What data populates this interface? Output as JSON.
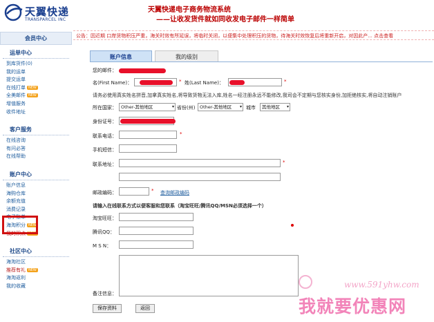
{
  "header": {
    "logo_cn": "天翼快递",
    "logo_en": "TRANSPARCEL INC",
    "slogan1": "天翼快递电子商务物流系统",
    "slogan2": "——让收发货件就如同收发电子邮件一样简单"
  },
  "sidebar": {
    "title": "会员中心",
    "sections": {
      "shipping": {
        "title": "运单中心",
        "items": [
          "到库货件(0)",
          "我的运单",
          "提交运单",
          "在线打单",
          "全美邮件",
          "增值服务",
          "收件地址"
        ],
        "badges": {
          "print": "NEW",
          "mail": "NEW"
        }
      },
      "service": {
        "title": "客户服务",
        "items": [
          "在线咨询",
          "有问必答",
          "在线帮助"
        ]
      },
      "account": {
        "title": "账户中心",
        "items": [
          "账户信息",
          "海购仓库",
          "余额充值",
          "消费记录",
          "电子账单",
          "海淘积分",
          "我的积点"
        ],
        "badges": {
          "points": "NEW",
          "credits": "NEW"
        }
      },
      "community": {
        "title": "社区中心",
        "items": [
          "海淘社区",
          "推荐有礼",
          "海淘返利",
          "我的收藏"
        ],
        "badges": {
          "referral": "NEW"
        }
      }
    }
  },
  "main": {
    "notice": "公告：因近期 口岸货物积压严重，海关时效有所延误，将临时关闭，以便集中处理积压的货物，待海关时效恢复后将重新开启，对因此产... 点击查看",
    "tabs": [
      "账户信息",
      "我的级别"
    ],
    "form": {
      "email_label": "您的邮件：",
      "first_name_label": "名(First Name)：",
      "last_name_label": "姓(Last Name)：",
      "required_mark": "*",
      "name_note": "请务必使用真实姓名拼音,加拿真实姓名,将导致货物无法入库,姓名一经注册永远不能修改,我司会不定期与您核实身份,加拒绝核实,将自动注销账户",
      "country_label": "所在国家：",
      "country_value": "Other-其他地区",
      "province_label": "省份(州)",
      "province_value": "Other-其他地区",
      "city_label": "城市",
      "city_value": "其他地区",
      "id_label": "身份证号：",
      "phone_label": "联系电话：",
      "mobile_label": "手机短信：",
      "address_label": "联系地址：",
      "zip_label": "邮政编码：",
      "zip_link": "查询邮政编码",
      "im_note": "请输入在线联系方式以便客服和您联系（淘宝旺旺/腾讯QQ/MSN必须选择一个）",
      "wangwang_label": "淘宝旺旺：",
      "qq_label": "腾讯QQ：",
      "msn_label": "M S N：",
      "remark_label": "备注信息：",
      "save_button": "保存资料",
      "back_button": "返回"
    }
  },
  "watermark": {
    "url": "www.591yhw.com",
    "text": "我就要优惠网"
  },
  "colors": {
    "brand_blue": "#1a3f8f",
    "slogan_red": "#bb0000",
    "highlight_red": "#d01010",
    "redaction": "#e8102a"
  }
}
